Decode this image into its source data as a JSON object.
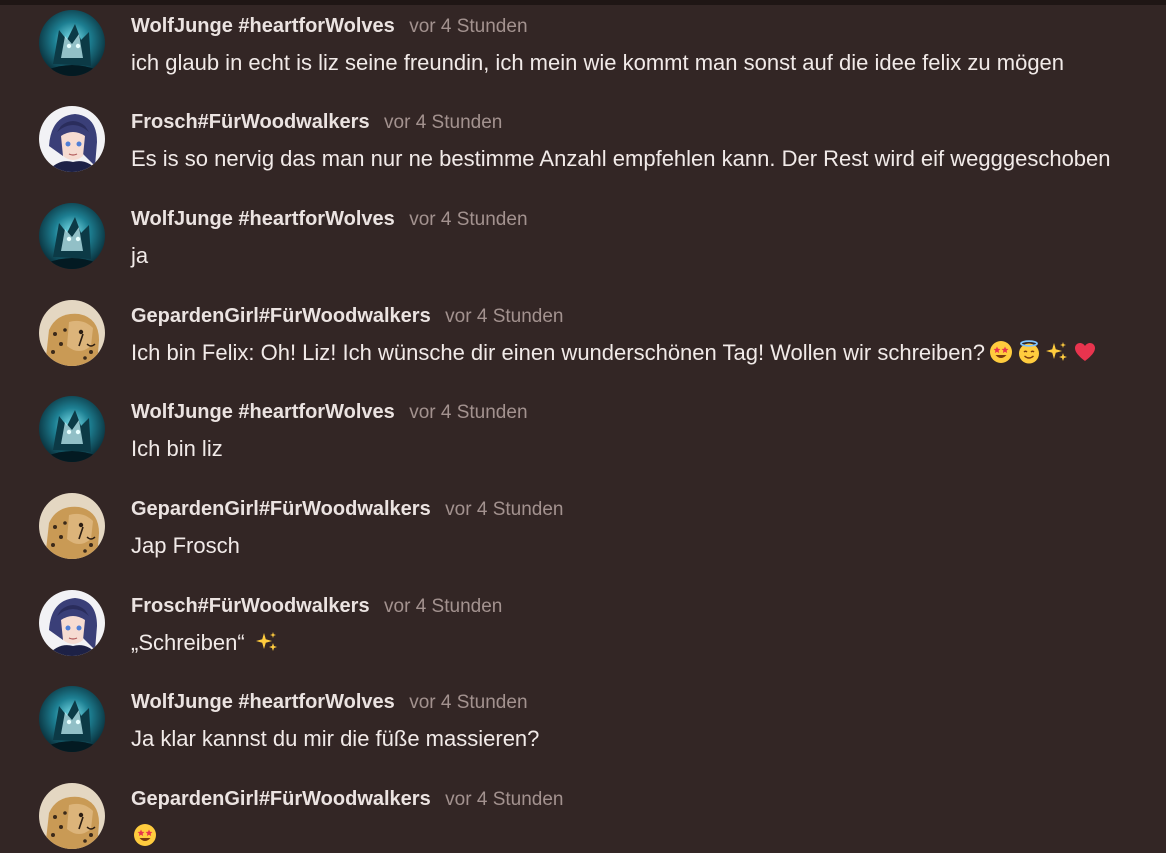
{
  "messages": [
    {
      "author": "WolfJunge #heartforWolves",
      "time": "vor 4 Stunden",
      "text": "ich glaub in echt is liz seine freundin, ich mein wie kommt man sonst auf die idee felix zu mögen",
      "avatar": "wolf-avatar",
      "emojis": []
    },
    {
      "author": "Frosch#FürWoodwalkers",
      "time": "vor 4 Stunden",
      "text": "Es is so nervig das man nur ne bestimme Anzahl empfehlen kann. Der Rest wird eif wegggeschoben",
      "avatar": "anime-avatar",
      "emojis": []
    },
    {
      "author": "WolfJunge #heartforWolves",
      "time": "vor 4 Stunden",
      "text": "ja",
      "avatar": "wolf-avatar",
      "emojis": []
    },
    {
      "author": "GepardenGirl#FürWoodwalkers",
      "time": "vor 4 Stunden",
      "text": "Ich bin Felix: Oh! Liz! Ich wünsche dir einen wunderschönen Tag! Wollen wir schreiben?",
      "avatar": "cheetah-avatar",
      "emojis": [
        "star-struck-emoji",
        "smiling-face-with-halo-emoji",
        "sparkles-emoji",
        "red-heart-emoji"
      ]
    },
    {
      "author": "WolfJunge #heartforWolves",
      "time": "vor 4 Stunden",
      "text": "Ich bin liz",
      "avatar": "wolf-avatar",
      "emojis": []
    },
    {
      "author": "GepardenGirl#FürWoodwalkers",
      "time": "vor 4 Stunden",
      "text": "Jap Frosch",
      "avatar": "cheetah-avatar",
      "emojis": []
    },
    {
      "author": "Frosch#FürWoodwalkers",
      "time": "vor 4 Stunden",
      "text": "„Schreiben“",
      "avatar": "anime-avatar",
      "emojis": [
        "sparkles-emoji"
      ]
    },
    {
      "author": "WolfJunge #heartforWolves",
      "time": "vor 4 Stunden",
      "text": "Ja klar kannst du mir die füße massieren?",
      "avatar": "wolf-avatar",
      "emojis": []
    },
    {
      "author": "GepardenGirl#FürWoodwalkers",
      "time": "vor 4 Stunden",
      "text": "",
      "avatar": "cheetah-avatar",
      "emojis": [
        "star-struck-emoji"
      ]
    }
  ],
  "colors": {
    "background": "#332625",
    "author": "#ebe3e1",
    "timestamp": "#a3928f",
    "message_text": "#f1eae8"
  }
}
